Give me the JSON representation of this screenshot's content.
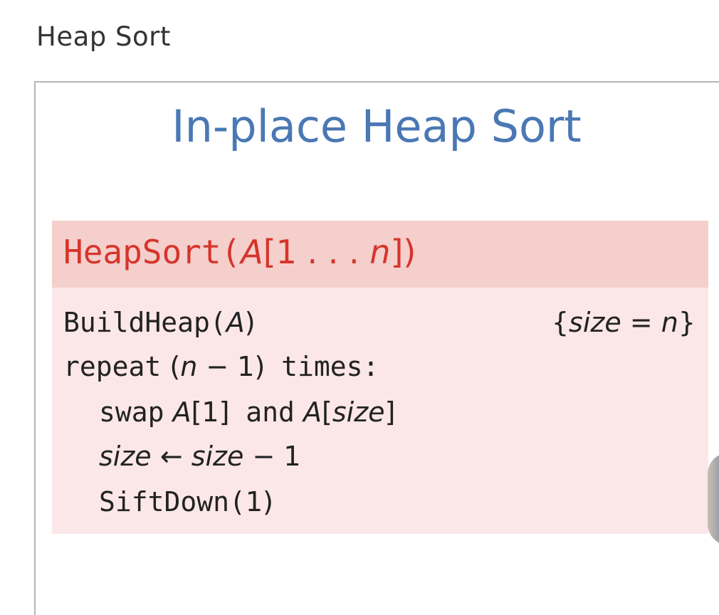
{
  "page": {
    "heading": "Heap Sort"
  },
  "slide": {
    "title": "In-place Heap Sort",
    "algorithm": {
      "name_fn": "HeapSort(",
      "name_arg": "A",
      "name_range_open": "[1 . . . ",
      "name_range_var": "n",
      "name_close": "])",
      "line1": {
        "fn": "BuildHeap(",
        "arg": "A",
        "close": ")"
      },
      "note": {
        "open": "{",
        "var": "size",
        "eq": " = ",
        "val": "n",
        "close": "}"
      },
      "line2": {
        "kw": "repeat",
        "paren_open": " (",
        "var": "n",
        "rest": " − 1)",
        "kw2": " times:"
      },
      "line3": {
        "kw": "swap",
        "a1": " A",
        "idx1": "[1]",
        "kw2": " and",
        "a2": " A",
        "idx2_open": "[",
        "idx2_var": "size",
        "idx2_close": "]"
      },
      "line4": {
        "var1": "size",
        "arrow": " ← ",
        "var2": "size",
        "rest": " − 1"
      },
      "line5": {
        "fn": "SiftDown(",
        "arg": "1",
        "close": ")"
      }
    }
  },
  "colors": {
    "title_blue": "#4a78b4",
    "algo_red": "#d7342b",
    "header_bg": "#f4cfcc",
    "body_bg": "#fbe7e7"
  }
}
